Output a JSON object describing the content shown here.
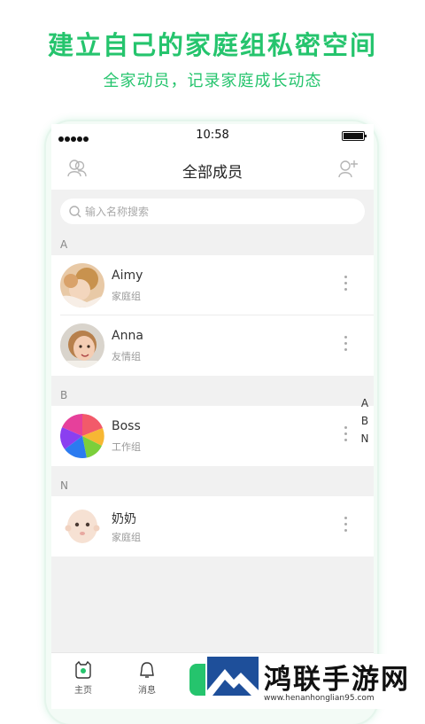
{
  "promo": {
    "title": "建立自己的家庭组私密空间",
    "subtitle": "全家动员，记录家庭成长动态"
  },
  "status_bar": {
    "time": "10:58"
  },
  "header": {
    "title": "全部成员",
    "left_icon": "group-icon",
    "right_icon": "add-user-icon"
  },
  "search": {
    "placeholder": "输入名称搜索",
    "value": ""
  },
  "sections": [
    {
      "letter": "A",
      "members": [
        {
          "name": "Aimy",
          "group": "家庭组"
        },
        {
          "name": "Anna",
          "group": "友情组"
        }
      ]
    },
    {
      "letter": "B",
      "members": [
        {
          "name": "Boss",
          "group": "工作组"
        }
      ]
    },
    {
      "letter": "N",
      "members": [
        {
          "name": "奶奶",
          "group": "家庭组"
        }
      ]
    }
  ],
  "index_bar": [
    "A",
    "B",
    "N"
  ],
  "tabs": [
    {
      "label": "主页",
      "icon": "home-icon"
    },
    {
      "label": "消息",
      "icon": "message-icon"
    }
  ],
  "watermark": {
    "text": "鸿联手游网",
    "url": "www.henanhonglian95.com"
  },
  "colors": {
    "accent": "#25c46d",
    "background": "#f1f1f1"
  }
}
